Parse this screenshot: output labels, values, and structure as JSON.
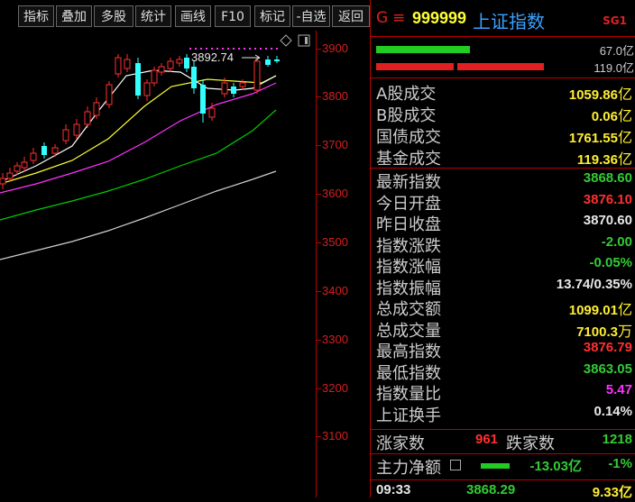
{
  "toolbar": {
    "buttons": [
      "指标",
      "叠加",
      "多股",
      "统计",
      "画线",
      "F10",
      "标记",
      "-自选",
      "返回"
    ]
  },
  "chart": {
    "peak_label": "3892.74",
    "y_ticks": [
      "3900",
      "3800",
      "3700",
      "3600",
      "3500",
      "3400",
      "3300",
      "3200",
      "3100"
    ],
    "colors": {
      "up": "#ff3030",
      "down": "#33ffff",
      "ma5": "#ffffff",
      "ma10": "#ffff33",
      "ma20": "#ff33ff",
      "ma60": "#00cc00",
      "ma120": "#cccccc"
    }
  },
  "header": {
    "prefix": "G",
    "menu_icon": "menu-icon",
    "code": "999999",
    "name": "上证指数",
    "badge": "SG1"
  },
  "ratio_bars": {
    "up_value": "67.0亿",
    "down_value": "119.0亿"
  },
  "turnover": [
    {
      "label": "A股成交",
      "value": "1059.86",
      "unit": "亿",
      "color": "yellow"
    },
    {
      "label": "B股成交",
      "value": "0.06",
      "unit": "亿",
      "color": "yellow"
    },
    {
      "label": "国债成交",
      "value": "1761.55",
      "unit": "亿",
      "color": "yellow"
    },
    {
      "label": "基金成交",
      "value": "119.36",
      "unit": "亿",
      "color": "yellow"
    }
  ],
  "stats": [
    {
      "label": "最新指数",
      "value": "3868.60",
      "unit": "",
      "color": "green"
    },
    {
      "label": "今日开盘",
      "value": "3876.10",
      "unit": "",
      "color": "red"
    },
    {
      "label": "昨日收盘",
      "value": "3870.60",
      "unit": "",
      "color": "white"
    },
    {
      "label": "指数涨跌",
      "value": "-2.00",
      "unit": "",
      "color": "green"
    },
    {
      "label": "指数涨幅",
      "value": "-0.05%",
      "unit": "",
      "color": "green"
    },
    {
      "label": "指数振幅",
      "value": "13.74/0.35%",
      "unit": "",
      "color": "white"
    },
    {
      "label": "总成交额",
      "value": "1099.01",
      "unit": "亿",
      "color": "yellow"
    },
    {
      "label": "总成交量",
      "value": "7100.3",
      "unit": "万",
      "color": "yellow"
    },
    {
      "label": "最高指数",
      "value": "3876.79",
      "unit": "",
      "color": "red"
    },
    {
      "label": "最低指数",
      "value": "3863.05",
      "unit": "",
      "color": "green"
    },
    {
      "label": "指数量比",
      "value": "5.47",
      "unit": "",
      "color": "mag"
    },
    {
      "label": "上证换手",
      "value": "0.14%",
      "unit": "",
      "color": "white"
    }
  ],
  "breadth": {
    "up_label": "涨家数",
    "up_value": "961",
    "down_label": "跌家数",
    "down_value": "1218"
  },
  "mainforce": {
    "label": "主力净额",
    "value": "-13.03亿",
    "pct": "-1%"
  },
  "tick": {
    "time": "09:33",
    "price": "3868.29",
    "volume": "9.33亿"
  }
}
